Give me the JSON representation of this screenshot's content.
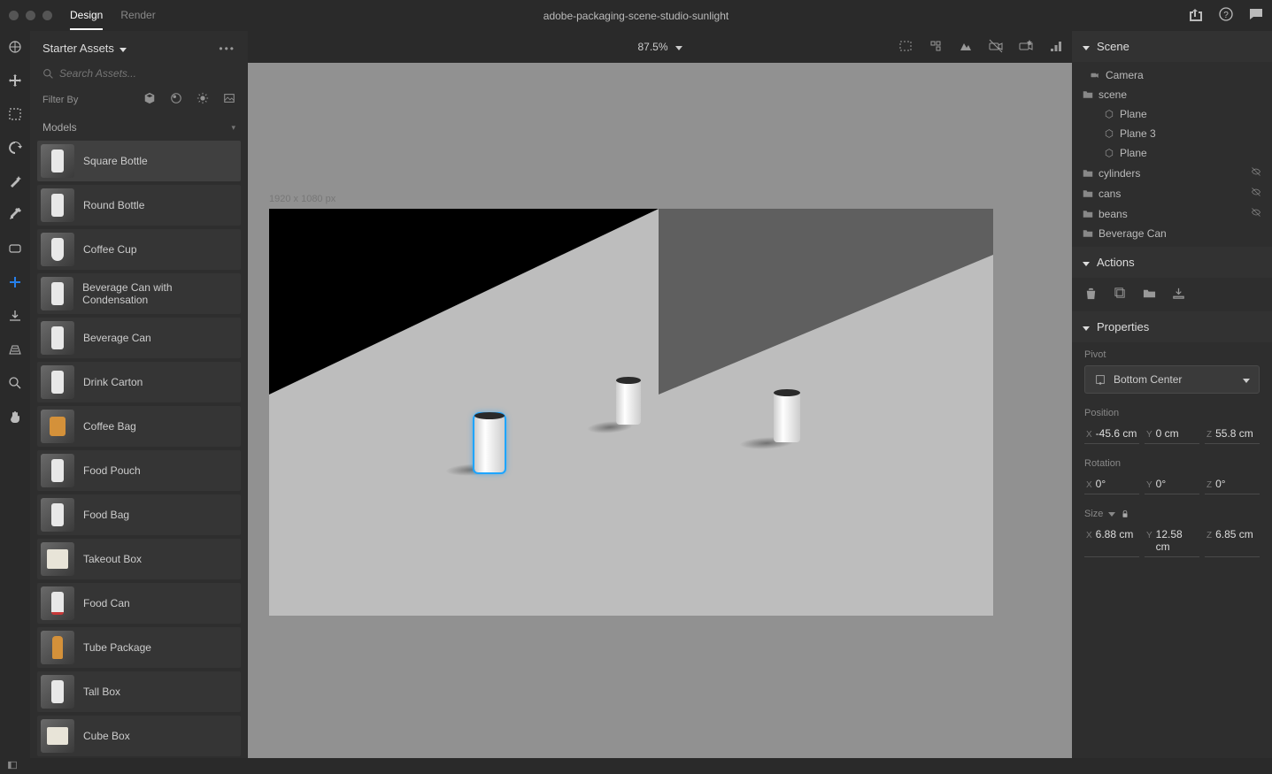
{
  "titlebar": {
    "tabs": {
      "design": "Design",
      "render": "Render"
    },
    "title": "adobe-packaging-scene-studio-sunlight"
  },
  "assets": {
    "header": "Starter Assets",
    "search_placeholder": "Search Assets...",
    "filter_label": "Filter By",
    "category": "Models",
    "items": [
      "Square Bottle",
      "Round Bottle",
      "Coffee Cup",
      "Beverage Can with Condensation",
      "Beverage Can",
      "Drink Carton",
      "Coffee Bag",
      "Food Pouch",
      "Food Bag",
      "Takeout Box",
      "Food Can",
      "Tube Package",
      "Tall Box",
      "Cube Box"
    ]
  },
  "viewport": {
    "zoom": "87.5%",
    "canvas_dims": "1920 x 1080 px"
  },
  "scene": {
    "header": "Scene",
    "items": {
      "camera": "Camera",
      "scene": "scene",
      "plane1": "Plane",
      "plane3": "Plane 3",
      "plane2": "Plane",
      "cylinders": "cylinders",
      "cans": "cans",
      "beans": "beans",
      "bev": "Beverage Can"
    }
  },
  "actions": {
    "header": "Actions"
  },
  "properties": {
    "header": "Properties",
    "pivot_label": "Pivot",
    "pivot_value": "Bottom Center",
    "position_label": "Position",
    "position": {
      "x": "-45.6 cm",
      "y": "0 cm",
      "z": "55.8 cm"
    },
    "rotation_label": "Rotation",
    "rotation": {
      "x": "0°",
      "y": "0°",
      "z": "0°"
    },
    "size_label": "Size",
    "size": {
      "x": "6.88 cm",
      "y": "12.58 cm",
      "z": "6.85 cm"
    }
  }
}
